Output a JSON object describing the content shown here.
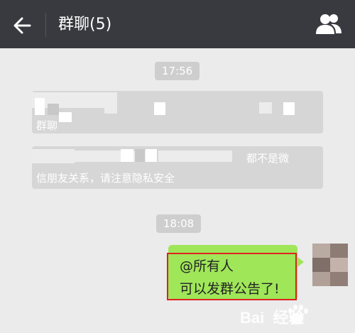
{
  "header": {
    "title": "群聊(5)",
    "back_icon": "back-arrow-icon",
    "members_icon": "group-members-icon"
  },
  "chat": {
    "timestamps": [
      "17:56",
      "18:08"
    ],
    "system_messages": [
      {
        "lines": [
          "群聊"
        ]
      },
      {
        "lines": [
          "都不是微",
          "信朋友关系，请注意隐私安全"
        ]
      }
    ],
    "sent_message": {
      "lines": [
        "@所有人",
        "可以发群公告了!"
      ],
      "bubble_color": "#9fe659",
      "highlight_color": "#e02020"
    }
  },
  "watermark": {
    "text": "Bai  经验",
    "icon": "baidu-paw-icon"
  },
  "colors": {
    "topbar": "#393a3f",
    "background": "#ebebeb",
    "system_bubble": "#d6d6d6"
  }
}
